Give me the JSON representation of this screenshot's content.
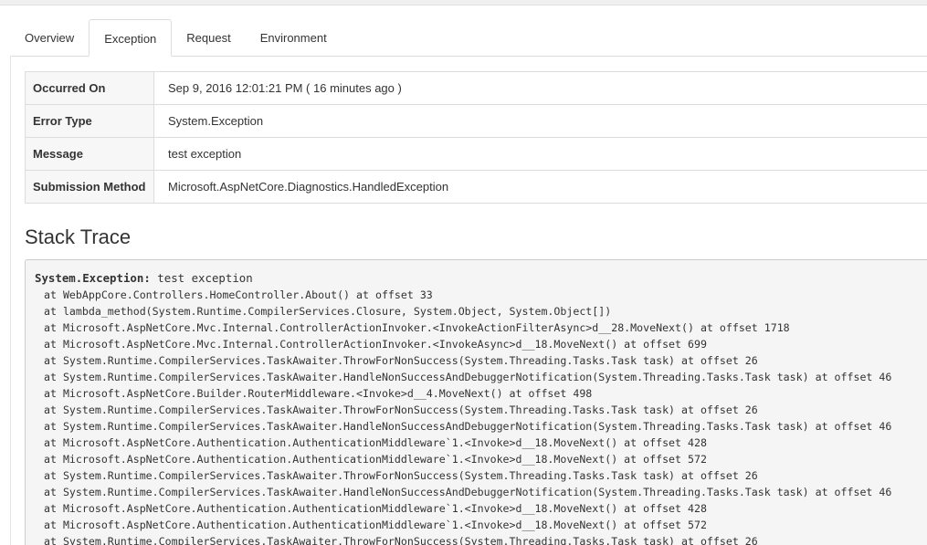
{
  "tabs": [
    {
      "label": "Overview",
      "active": false
    },
    {
      "label": "Exception",
      "active": true
    },
    {
      "label": "Request",
      "active": false
    },
    {
      "label": "Environment",
      "active": false
    }
  ],
  "details": {
    "occurred_on": {
      "label": "Occurred On",
      "value": "Sep 9, 2016 12:01:21 PM ( 16 minutes ago )"
    },
    "error_type": {
      "label": "Error Type",
      "value": "System.Exception"
    },
    "message": {
      "label": "Message",
      "value": "test exception"
    },
    "submission_method": {
      "label": "Submission Method",
      "value": "Microsoft.AspNetCore.Diagnostics.HandledException"
    }
  },
  "stack_trace": {
    "title": "Stack Trace",
    "exception_type": "System.Exception:",
    "exception_message": " test exception",
    "frames": [
      "at WebAppCore.Controllers.HomeController.About() at offset 33",
      "at lambda_method(System.Runtime.CompilerServices.Closure, System.Object, System.Object[])",
      "at Microsoft.AspNetCore.Mvc.Internal.ControllerActionInvoker.<InvokeActionFilterAsync>d__28.MoveNext() at offset 1718",
      "at Microsoft.AspNetCore.Mvc.Internal.ControllerActionInvoker.<InvokeAsync>d__18.MoveNext() at offset 699",
      "at System.Runtime.CompilerServices.TaskAwaiter.ThrowForNonSuccess(System.Threading.Tasks.Task task) at offset 26",
      "at System.Runtime.CompilerServices.TaskAwaiter.HandleNonSuccessAndDebuggerNotification(System.Threading.Tasks.Task task) at offset 46",
      "at Microsoft.AspNetCore.Builder.RouterMiddleware.<Invoke>d__4.MoveNext() at offset 498",
      "at System.Runtime.CompilerServices.TaskAwaiter.ThrowForNonSuccess(System.Threading.Tasks.Task task) at offset 26",
      "at System.Runtime.CompilerServices.TaskAwaiter.HandleNonSuccessAndDebuggerNotification(System.Threading.Tasks.Task task) at offset 46",
      "at Microsoft.AspNetCore.Authentication.AuthenticationMiddleware`1.<Invoke>d__18.MoveNext() at offset 428",
      "at Microsoft.AspNetCore.Authentication.AuthenticationMiddleware`1.<Invoke>d__18.MoveNext() at offset 572",
      "at System.Runtime.CompilerServices.TaskAwaiter.ThrowForNonSuccess(System.Threading.Tasks.Task task) at offset 26",
      "at System.Runtime.CompilerServices.TaskAwaiter.HandleNonSuccessAndDebuggerNotification(System.Threading.Tasks.Task task) at offset 46",
      "at Microsoft.AspNetCore.Authentication.AuthenticationMiddleware`1.<Invoke>d__18.MoveNext() at offset 428",
      "at Microsoft.AspNetCore.Authentication.AuthenticationMiddleware`1.<Invoke>d__18.MoveNext() at offset 572",
      "at System.Runtime.CompilerServices.TaskAwaiter.ThrowForNonSuccess(System.Threading.Tasks.Task task) at offset 26"
    ]
  }
}
